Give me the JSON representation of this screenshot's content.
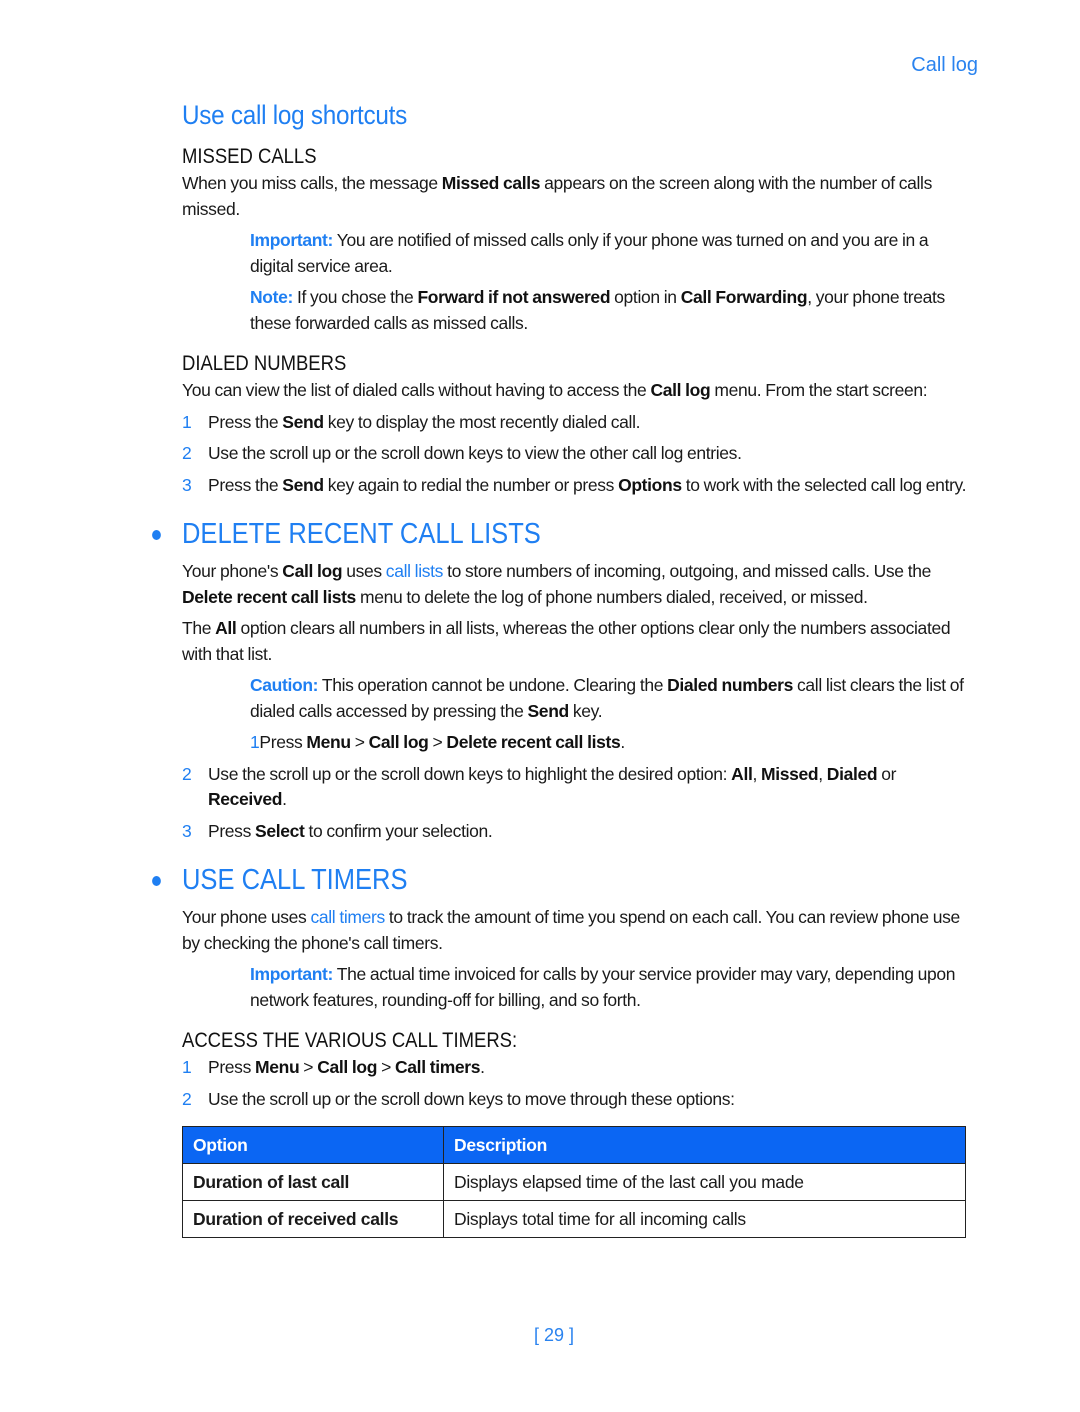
{
  "running_head": "Call log",
  "page_number": "[ 29 ]",
  "colors": {
    "accent": "#1f7ff2",
    "table_header_bg": "#0b66f3",
    "text": "#1a1a1a"
  },
  "shortcuts": {
    "title": "Use call log shortcuts",
    "missed": {
      "heading": "MISSED CALLS",
      "body": [
        "When you miss calls, the message ",
        "Missed calls",
        " appears on the screen along with the number of calls missed."
      ],
      "important": {
        "label": "Important:",
        "text": " You are notified of missed calls only if your phone was turned on and you are in a digital service area."
      },
      "note": {
        "label": "Note:",
        "parts": [
          " If you chose the ",
          "Forward if not answered",
          " option in ",
          "Call Forwarding",
          ", your phone treats these forwarded calls as missed calls."
        ]
      }
    },
    "dialed": {
      "heading": "DIALED NUMBERS",
      "body": [
        "You can view the list of dialed calls without having to access the ",
        "Call log",
        " menu. From the start screen:"
      ],
      "steps": [
        {
          "num": "1",
          "parts": [
            "Press the ",
            "Send",
            " key to display the most recently dialed call."
          ]
        },
        {
          "num": "2",
          "parts": [
            "Use the scroll up or the scroll down keys to view the other call log entries."
          ]
        },
        {
          "num": "3",
          "parts": [
            "Press the ",
            "Send",
            " key again to redial the number or press ",
            "Options",
            " to work with the selected call log entry."
          ]
        }
      ]
    }
  },
  "delete": {
    "heading": "DELETE RECENT CALL LISTS",
    "para1": [
      "Your phone's ",
      "Call log",
      " uses ",
      "call lists",
      " to store numbers of incoming, outgoing, and missed calls. Use the ",
      "Delete recent call lists",
      " menu to delete the log of phone numbers dialed, received, or missed."
    ],
    "para2": [
      "The ",
      "All",
      " option clears all numbers in all lists, whereas the other options clear only the numbers associated with that list."
    ],
    "caution": {
      "label": "Caution:",
      "parts": [
        " This operation cannot be undone. Clearing the ",
        "Dialed numbers",
        " call list clears the list of dialed calls accessed by pressing the ",
        "Send",
        " key."
      ]
    },
    "steps": [
      {
        "num": "1",
        "parts": [
          "Press ",
          "Menu",
          " > ",
          "Call log",
          " > ",
          "Delete recent call lists",
          "."
        ]
      },
      {
        "num": "2",
        "parts": [
          "Use the scroll up or the scroll down keys to highlight the desired option: ",
          "All",
          ", ",
          "Missed",
          ", ",
          "Dialed",
          " or ",
          "Received",
          "."
        ]
      },
      {
        "num": "3",
        "parts": [
          "Press ",
          "Select",
          " to confirm your selection."
        ]
      }
    ]
  },
  "timers": {
    "heading": "USE CALL TIMERS",
    "para1": [
      "Your phone uses ",
      "call timers",
      " to track the amount of time you spend on each call. You can review phone use by checking the phone's call timers."
    ],
    "important": {
      "label": "Important:",
      "text": " The actual time invoiced for calls by your service provider may vary, depending upon network features, rounding-off for billing, and so forth."
    },
    "access_heading": "ACCESS THE VARIOUS CALL TIMERS:",
    "steps": [
      {
        "num": "1",
        "parts": [
          "Press ",
          "Menu",
          " > ",
          "Call log",
          " > ",
          "Call timers",
          "."
        ]
      },
      {
        "num": "2",
        "parts": [
          "Use the scroll up or the scroll down keys to move through these options:"
        ]
      }
    ],
    "table": {
      "headers": [
        "Option",
        "Description"
      ],
      "rows": [
        [
          "Duration of last call",
          "Displays elapsed time of the last call you made"
        ],
        [
          "Duration of received calls",
          "Displays total time for all incoming calls"
        ]
      ]
    }
  }
}
